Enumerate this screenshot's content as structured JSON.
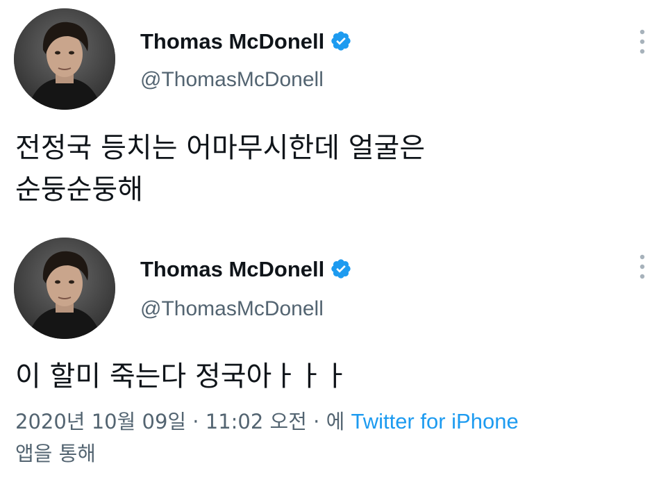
{
  "tweets": [
    {
      "author": {
        "display_name": "Thomas McDonell",
        "handle": "@ThomasMcDonell",
        "verified": true,
        "avatar_icon": "profile-photo"
      },
      "text": "전정국 등치는 어마무시한데 얼굴은\n순둥순둥해"
    },
    {
      "author": {
        "display_name": "Thomas McDonell",
        "handle": "@ThomasMcDonell",
        "verified": true,
        "avatar_icon": "profile-photo"
      },
      "text": "이 할미 죽는다 정국아ㅏㅏㅏ",
      "meta": {
        "date": "2020년 10월 09일",
        "sep1": " · ",
        "time": "11:02 오전",
        "sep2": " · ",
        "via_prefix": "에 ",
        "source": "Twitter for iPhone",
        "via_suffix": "앱을 통해"
      }
    }
  ],
  "icons": {
    "verified": "verified-badge-icon",
    "more": "more-options-icon"
  },
  "colors": {
    "text_primary": "#0f1419",
    "text_secondary": "#536471",
    "link": "#1d9bf0",
    "verified": "#1d9bf0",
    "background": "#ffffff"
  }
}
